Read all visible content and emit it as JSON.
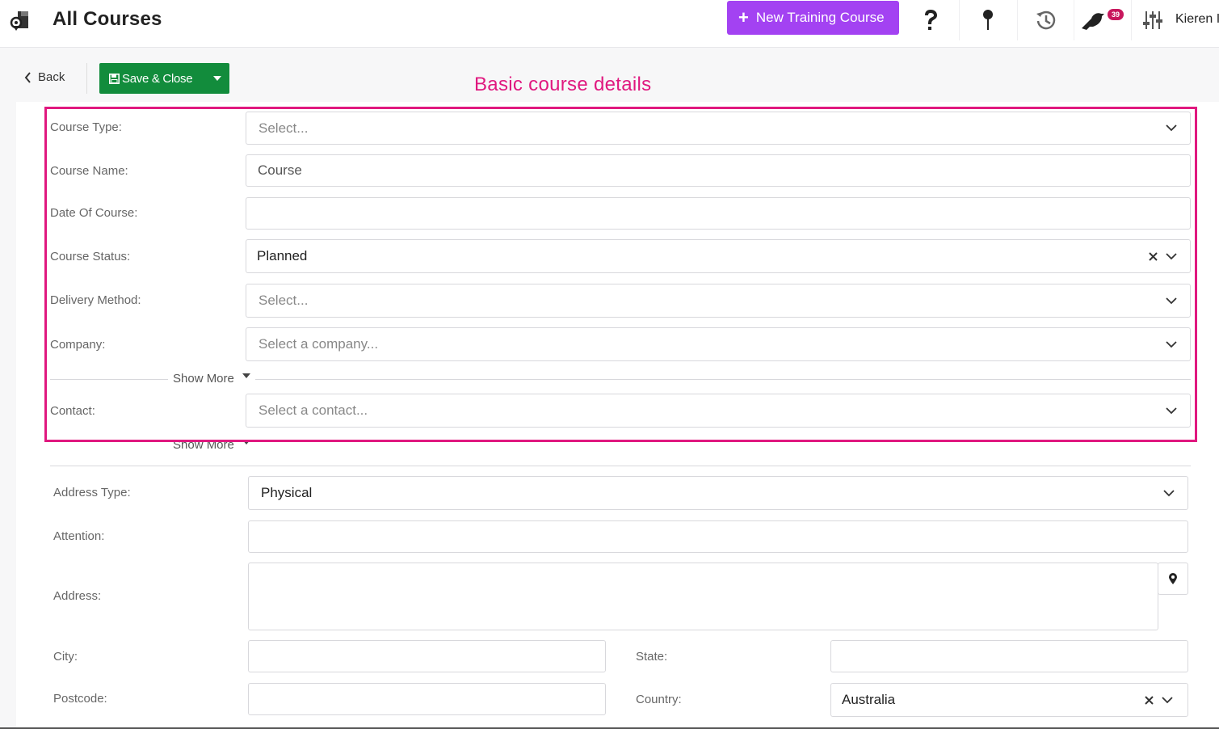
{
  "header": {
    "title": "All Courses",
    "new_course_label": "New Training Course",
    "notification_count": "39",
    "user_name": "Kieren I"
  },
  "toolbar": {
    "back_label": "Back",
    "save_label": "Save & Close"
  },
  "annotation": "Basic course details",
  "basic": {
    "course_type": {
      "label": "Course Type:",
      "placeholder": "Select..."
    },
    "course_name": {
      "label": "Course Name:",
      "value": "Course"
    },
    "date_of_course": {
      "label": "Date Of Course:",
      "value": ""
    },
    "course_status": {
      "label": "Course Status:",
      "value": "Planned"
    },
    "delivery_method": {
      "label": "Delivery Method:",
      "placeholder": "Select..."
    },
    "company": {
      "label": "Company:",
      "placeholder": "Select a company..."
    },
    "show_more_1": "Show More",
    "contact": {
      "label": "Contact:",
      "placeholder": "Select a contact..."
    },
    "show_more_2": "Show More"
  },
  "address": {
    "address_type": {
      "label": "Address Type:",
      "value": "Physical"
    },
    "attention": {
      "label": "Attention:",
      "value": ""
    },
    "address": {
      "label": "Address:",
      "value": ""
    },
    "city": {
      "label": "City:",
      "value": ""
    },
    "state": {
      "label": "State:",
      "value": ""
    },
    "postcode": {
      "label": "Postcode:",
      "value": ""
    },
    "country": {
      "label": "Country:",
      "value": "Australia"
    }
  },
  "colors": {
    "accent_purple": "#a342f2",
    "save_green": "#128c3c",
    "annotation_pink": "#e0187f",
    "badge_red": "#c8175d"
  },
  "icons": [
    "app-logo-icon",
    "help-icon",
    "pin-icon",
    "history-icon",
    "bird-icon",
    "settings-sliders-icon",
    "chevron-left-icon",
    "save-icon",
    "caret-down-icon",
    "chevron-down-icon",
    "clear-icon",
    "map-pin-icon"
  ]
}
